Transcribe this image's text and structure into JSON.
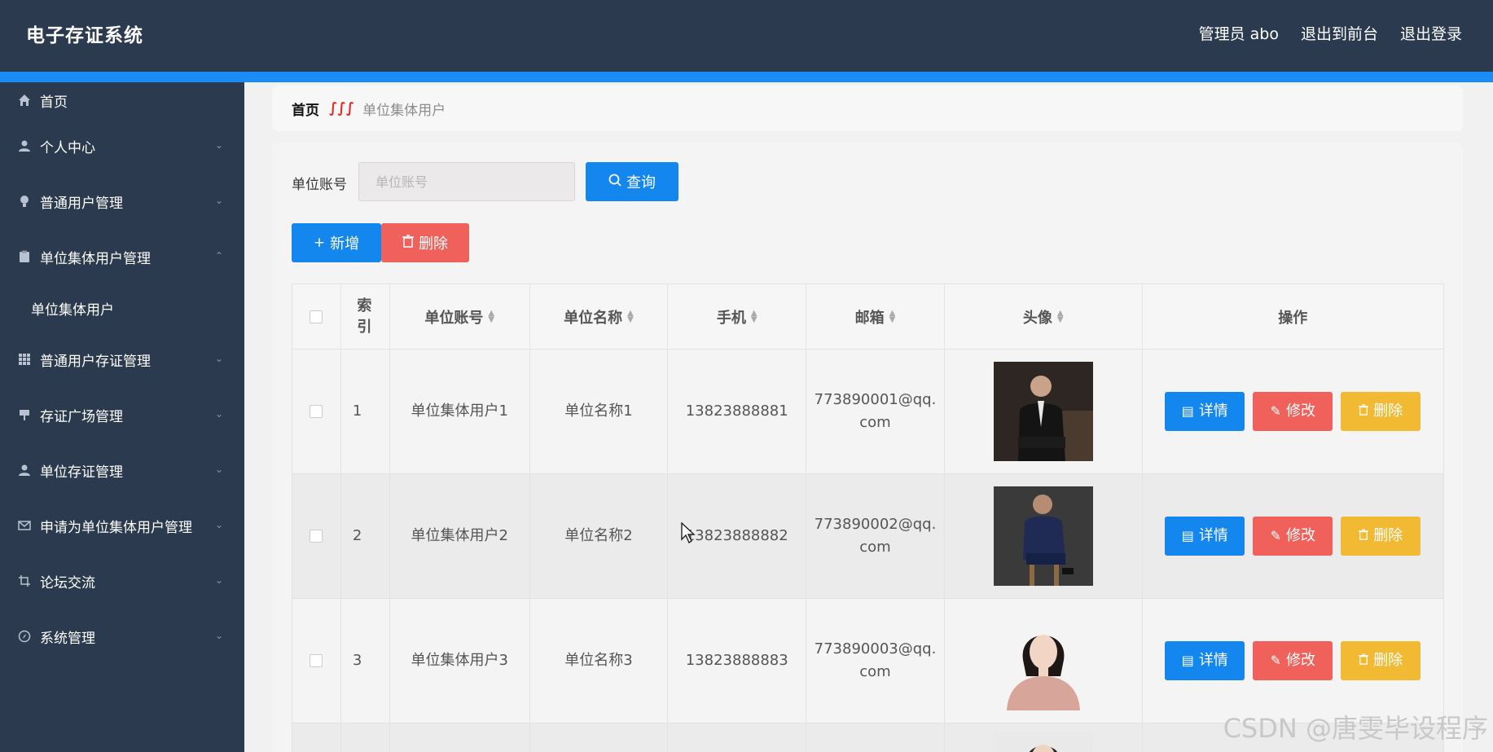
{
  "header": {
    "brand": "电子存证系统",
    "admin_label": "管理员 abo",
    "to_frontend": "退出到前台",
    "logout": "退出登录"
  },
  "sidebar": {
    "items": [
      {
        "label": "首页",
        "icon": "home-icon"
      },
      {
        "label": "个人中心",
        "icon": "user-icon"
      },
      {
        "label": "普通用户管理",
        "icon": "bulb-icon"
      },
      {
        "label": "单位集体用户管理",
        "icon": "clipboard-icon"
      },
      {
        "label": "普通用户存证管理",
        "icon": "grid-icon"
      },
      {
        "label": "存证广场管理",
        "icon": "flag-icon"
      },
      {
        "label": "单位存证管理",
        "icon": "user-icon"
      },
      {
        "label": "申请为单位集体用户管理",
        "icon": "mail-icon"
      },
      {
        "label": "论坛交流",
        "icon": "crop-icon"
      },
      {
        "label": "系统管理",
        "icon": "compass-icon"
      }
    ],
    "subitem": "单位集体用户"
  },
  "breadcrumb": {
    "home": "首页",
    "current": "单位集体用户"
  },
  "search": {
    "label": "单位账号",
    "placeholder": "单位账号",
    "query_button": "查询"
  },
  "actions": {
    "add": "新增",
    "delete": "删除"
  },
  "table": {
    "headers": [
      "索引",
      "单位账号",
      "单位名称",
      "手机",
      "邮箱",
      "头像",
      "操作"
    ],
    "rows": [
      {
        "index": "1",
        "account": "单位集体用户1",
        "name": "单位名称1",
        "phone": "13823888881",
        "email_1": "773890001@qq.",
        "email_2": "com"
      },
      {
        "index": "2",
        "account": "单位集体用户2",
        "name": "单位名称2",
        "phone": "13823888882",
        "email_1": "773890002@qq.",
        "email_2": "com"
      },
      {
        "index": "3",
        "account": "单位集体用户3",
        "name": "单位名称3",
        "phone": "13823888883",
        "email_1": "773890003@qq.",
        "email_2": "com"
      }
    ],
    "op_labels": {
      "detail": "详情",
      "edit": "修改",
      "delete": "删除"
    }
  },
  "watermark": "CSDN @唐雯毕设程序"
}
